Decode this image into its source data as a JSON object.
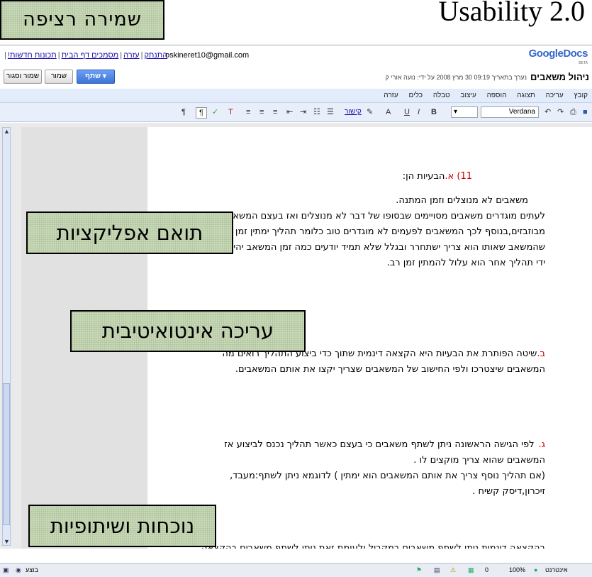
{
  "slide": {
    "title": "Usability 2.0",
    "callouts": [
      "שמירה רציפה",
      "תואם אפליקציות",
      "עריכה אינטואיטיבית",
      "נוכחות ושיתופיות"
    ]
  },
  "topbar": {
    "links": [
      "התנתק",
      "עזרה",
      "מסמכים דף הבית",
      "תכונות חדשות!"
    ],
    "email": "oskineret10@gmail.com",
    "logo_google": "Google",
    "logo_docs": "Docs",
    "beta": "BETA"
  },
  "docbar": {
    "title": "ניהול משאבים",
    "edit_info": "נערך בתאריך 09:19 30 מרץ 2008 על ידי: נועה אורי ק",
    "share": "שתף ▾",
    "save": "שמור",
    "save_close": "שמור וסגור"
  },
  "menu": [
    "קובץ",
    "עריכה",
    "תצוגה",
    "הוספה",
    "עיצוב",
    "טבלה",
    "כלים",
    "עזרה"
  ],
  "toolbar": {
    "font": "Verdana",
    "link": "קישור",
    "bold": "B",
    "italic": "I",
    "underline": "U",
    "text_color": "A",
    "icons": [
      "save-icon",
      "print-icon",
      "redo-icon",
      "undo-icon",
      "highlight-icon",
      "bullet-list-icon",
      "numbered-list-icon",
      "indent-icon",
      "outdent-icon",
      "align-right-icon",
      "align-center-icon",
      "align-left-icon",
      "clear-format-icon",
      "spellcheck-icon",
      "rtl-icon",
      "ltr-icon"
    ]
  },
  "document": {
    "p1_num": "11) א.",
    "p1_head": "הבעיות הן:",
    "p1_lines": [
      "משאבים לא מנוצלים וזמן המתנה.",
      "לעתים מוגדרים משאבים מסויימים שבסופו של דבר לא מנוצלים ואז בעצם המשאבים",
      "מבוזבזים,בנוסף לכך המשאבים לפעמים לא מוגדרים טוב כלומר תהליך ימתין זמן רב עד",
      "שהמשאב שאותו הוא צריך ישתחרר ובגלל שלא תמיד יודעים כמה זמן המשאב יהיה תפוס על",
      "ידי תהליך אחר הוא עלול להמתין זמן רב."
    ],
    "p2_num": "ב.",
    "p2_lines": [
      "שיטה הפותרת את הבעיות היא הקצאה דינמית שתוך כדי ביצוע התהליך רואים מה",
      "המשאבים שיצטרכו ולפי החישוב של המשאבים שצריך יקצו את  אותם המשאבים."
    ],
    "p3_num": "ג.",
    "p3_lines": [
      "לפי הגישה הראשונה  ניתן לשתף משאבים כי בעצם כאשר תהליך נכנס לביצוע אז",
      "המשאבים שהוא צריך מוקצים לו .",
      "(אם תהליך נוסף צריך את אותם המשאבים הוא ימתין )  לדוגמא ניתן לשתף:מעבד,",
      "זיכרון,דיסק קשיח ."
    ],
    "p4_line": "בהקצאה דינמית ניתן לשתף משאבים במקביל ולעומת זאת ניתן לשתף משאבים בהקצאה"
  },
  "statusbar": {
    "internet": "אינטרנט",
    "zoom": "100%",
    "count": "0",
    "run": "בוצע"
  },
  "colors": {
    "callout_bg": "#c7d9b5",
    "menubar_bg": "#e3ecfa",
    "toolbar_bg": "#e8effb",
    "number_red": "#cc0000",
    "share_blue": "#3d75d6"
  }
}
